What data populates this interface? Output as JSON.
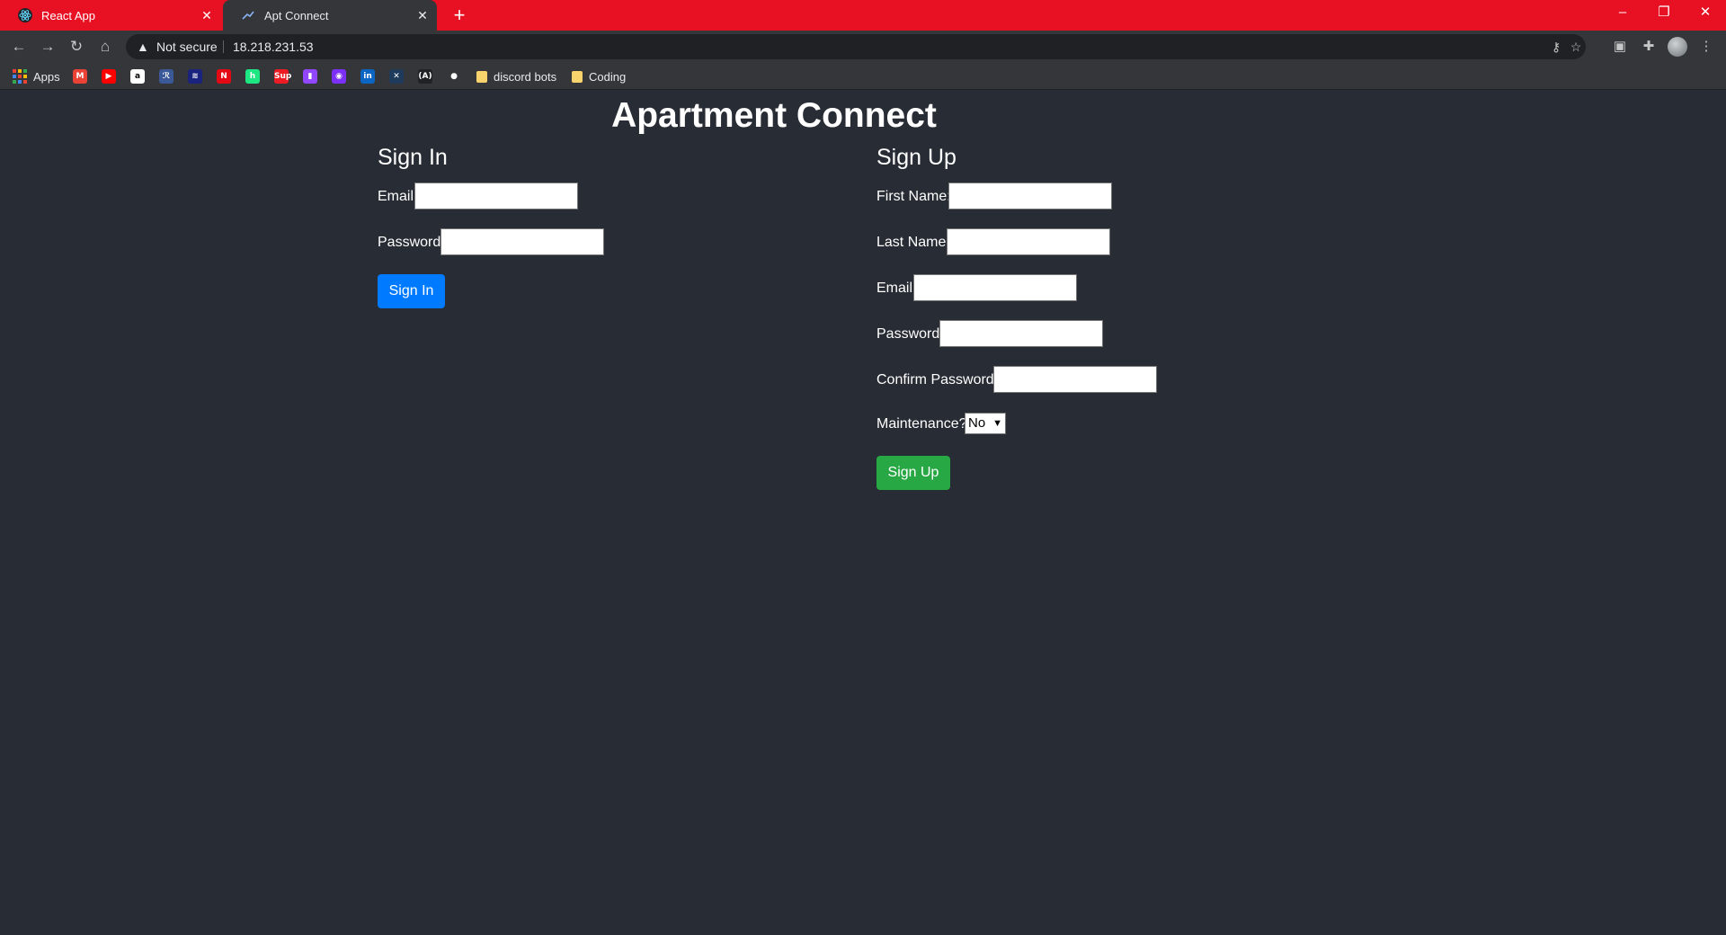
{
  "browser": {
    "tabs": [
      {
        "title": "React App",
        "favicon": "react-atom-icon",
        "active": false
      },
      {
        "title": "Apt Connect",
        "favicon": "page-icon",
        "active": true
      }
    ],
    "new_tab_label": "+",
    "security_label": "Not secure",
    "url": "18.218.231.53",
    "tab_strip_color": "#e81123",
    "bookmarks": {
      "apps_label": "Apps",
      "folders": [
        {
          "label": "discord bots"
        },
        {
          "label": "Coding"
        }
      ],
      "icons": [
        {
          "name": "gmail-icon",
          "glyph": "M",
          "color": "#ea4335"
        },
        {
          "name": "youtube-icon",
          "glyph": "▶",
          "color": "#ff0000"
        },
        {
          "name": "amazon-icon",
          "glyph": "a",
          "color": "#ffffff"
        },
        {
          "name": "bookmark-icon-4",
          "glyph": "ℛ",
          "color": "#3b5998"
        },
        {
          "name": "bookmark-icon-5",
          "glyph": "≋",
          "color": "#1a237e"
        },
        {
          "name": "netflix-icon",
          "glyph": "N",
          "color": "#e50914"
        },
        {
          "name": "hulu-icon",
          "glyph": "h",
          "color": "#1ce783"
        },
        {
          "name": "supreme-icon",
          "glyph": "Sup",
          "color": "#ed1c24"
        },
        {
          "name": "twitch-icon",
          "glyph": "▮",
          "color": "#9146ff"
        },
        {
          "name": "messenger-icon",
          "glyph": "◉",
          "color": "#7b2ff7"
        },
        {
          "name": "linkedin-icon",
          "glyph": "in",
          "color": "#0a66c2"
        },
        {
          "name": "bookmark-icon-12",
          "glyph": "✕",
          "color": "#1f3b5c"
        },
        {
          "name": "bookmark-icon-13",
          "glyph": "(A)",
          "color": "#202124"
        },
        {
          "name": "github-icon",
          "glyph": "●",
          "color": "#35363a"
        }
      ]
    }
  },
  "app": {
    "title": "Apartment Connect",
    "sign_in": {
      "heading": "Sign In",
      "email_label": "Email:",
      "email_value": "",
      "password_label": "Password:",
      "password_value": "",
      "button_label": "Sign In",
      "button_color": "#007bff"
    },
    "sign_up": {
      "heading": "Sign Up",
      "first_name_label": "First Name:",
      "first_name_value": "",
      "last_name_label": "Last Name:",
      "last_name_value": "",
      "email_label": "Email:",
      "email_value": "",
      "password_label": "Password:",
      "password_value": "",
      "confirm_password_label": "Confirm Password:",
      "confirm_password_value": "",
      "maintenance_label": "Maintenance?",
      "maintenance_value": "No",
      "button_label": "Sign Up",
      "button_color": "#28a745"
    },
    "background_color": "#282c34"
  }
}
